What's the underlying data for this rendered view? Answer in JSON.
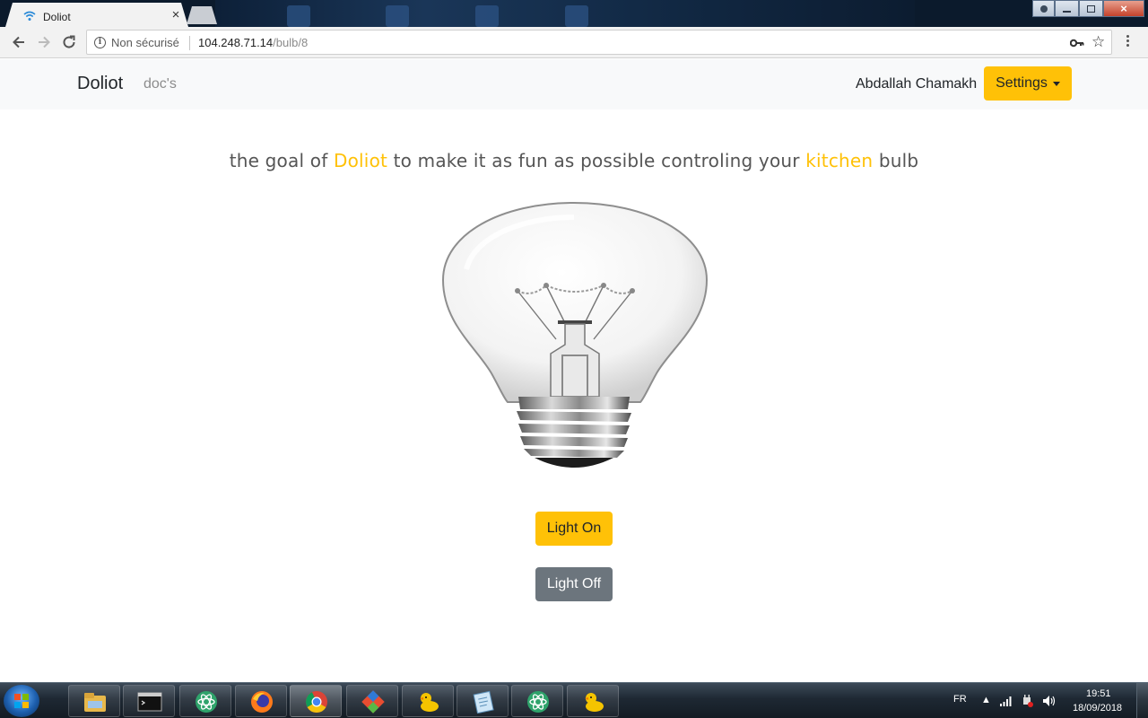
{
  "browser": {
    "tab_title": "Doliot",
    "security_label": "Non sécurisé",
    "url_host": "104.248.71.14",
    "url_path": "/bulb/8"
  },
  "navbar": {
    "brand": "Doliot",
    "docs_link": "doc's",
    "user_name": "Abdallah Chamakh",
    "settings_label": "Settings"
  },
  "headline": {
    "prefix": "the goal of ",
    "brand": "Doliot",
    "middle": " to make it as fun as possible controling your ",
    "room": "kitchen",
    "suffix": " bulb"
  },
  "bulb": {
    "state": "off",
    "image": "light-bulb"
  },
  "actions": {
    "on_label": "Light On",
    "off_label": "Light Off"
  },
  "taskbar": {
    "items": [
      "file-explorer-icon",
      "terminal-icon",
      "atom-icon",
      "firefox-icon",
      "chrome-icon",
      "git-icon",
      "duck-icon",
      "notepad-icon",
      "atom-icon",
      "duck-icon"
    ],
    "language": "FR",
    "time": "19:51",
    "date": "18/09/2018"
  },
  "colors": {
    "accent": "#ffc107",
    "secondary": "#6c757d",
    "navbar_bg": "#f8f9fa",
    "text": "#212529"
  }
}
